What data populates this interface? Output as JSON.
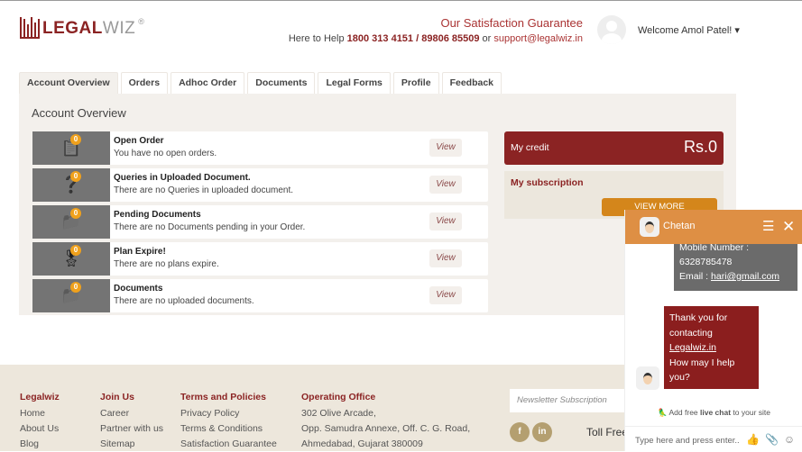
{
  "header": {
    "logo_text": "LEGAL",
    "logo_text2": "WIZ",
    "registered": "®",
    "guarantee": "Our Satisfaction Guarantee",
    "help_prefix": "Here to Help",
    "phone1": "1800 313 4151",
    "sep": "/",
    "phone2": "89806 85509",
    "or": "or",
    "email": "support@legalwiz.in",
    "welcome": "Welcome Amol Patel! ▾"
  },
  "tabs": [
    "Account Overview",
    "Orders",
    "Adhoc Order",
    "Documents",
    "Legal Forms",
    "Profile",
    "Feedback"
  ],
  "panel": {
    "title": "Account Overview",
    "rows": [
      {
        "icon": "clipboard-list-icon",
        "glyph": "📋",
        "count": "0",
        "title": "Open Order",
        "desc": "You have no open orders.",
        "view": "View"
      },
      {
        "icon": "question-bubble-icon",
        "glyph": "❓",
        "count": "0",
        "title": "Queries in Uploaded Document.",
        "desc": "There are no Queries in uploaded document.",
        "view": "View"
      },
      {
        "icon": "folder-icon",
        "glyph": "📁",
        "count": "0",
        "title": "Pending Documents",
        "desc": "There are no Documents pending in your Order.",
        "view": "View"
      },
      {
        "icon": "award-ribbon-icon",
        "glyph": "🎖",
        "count": "0",
        "title": "Plan Expire!",
        "desc": "There are no plans expire.",
        "view": "View"
      },
      {
        "icon": "folder-icon",
        "glyph": "📁",
        "count": "0",
        "title": "Documents",
        "desc": "There are no uploaded documents.",
        "view": "View"
      }
    ],
    "credit_label": "My credit",
    "credit_value": "Rs.0",
    "subscription_label": "My subscription",
    "subscription_button": "VIEW MORE SUBSCRIPTION"
  },
  "footer": {
    "cols": [
      {
        "title": "Legalwiz",
        "links": [
          "Home",
          "About Us",
          "Blog"
        ]
      },
      {
        "title": "Join Us",
        "links": [
          "Career",
          "Partner with us",
          "Sitemap"
        ]
      },
      {
        "title": "Terms and Policies",
        "links": [
          "Privacy Policy",
          "Terms & Conditions",
          "Satisfaction Guarantee"
        ]
      },
      {
        "title": "Operating Office",
        "links": [
          "302 Olive Arcade,",
          "Opp. Samudra Annexe, Off. C. G. Road,",
          "Ahmedabad, Gujarat 380009"
        ]
      }
    ],
    "newsletter_placeholder": "Newsletter Subscription",
    "facebook": "f",
    "linkedin": "in",
    "toll": "Toll Free"
  },
  "chat": {
    "agent": "Chetan",
    "mobile_label": "Mobile Number :",
    "mobile": "6328785478",
    "email_label": "Email :",
    "email": "hari@gmail.com",
    "msg1": "Thank you for",
    "msg2": "contacting",
    "msg_link": "Legalwiz.in",
    "msg3": "How may I help",
    "msg4": "you?",
    "powered_a": "Add free ",
    "powered_b": "live chat",
    "powered_c": " to your site",
    "input_placeholder": "Type here and press enter.."
  },
  "colors": {
    "brand": "#8b2323",
    "accent": "#d4861b",
    "chat_header": "#de8f44"
  }
}
